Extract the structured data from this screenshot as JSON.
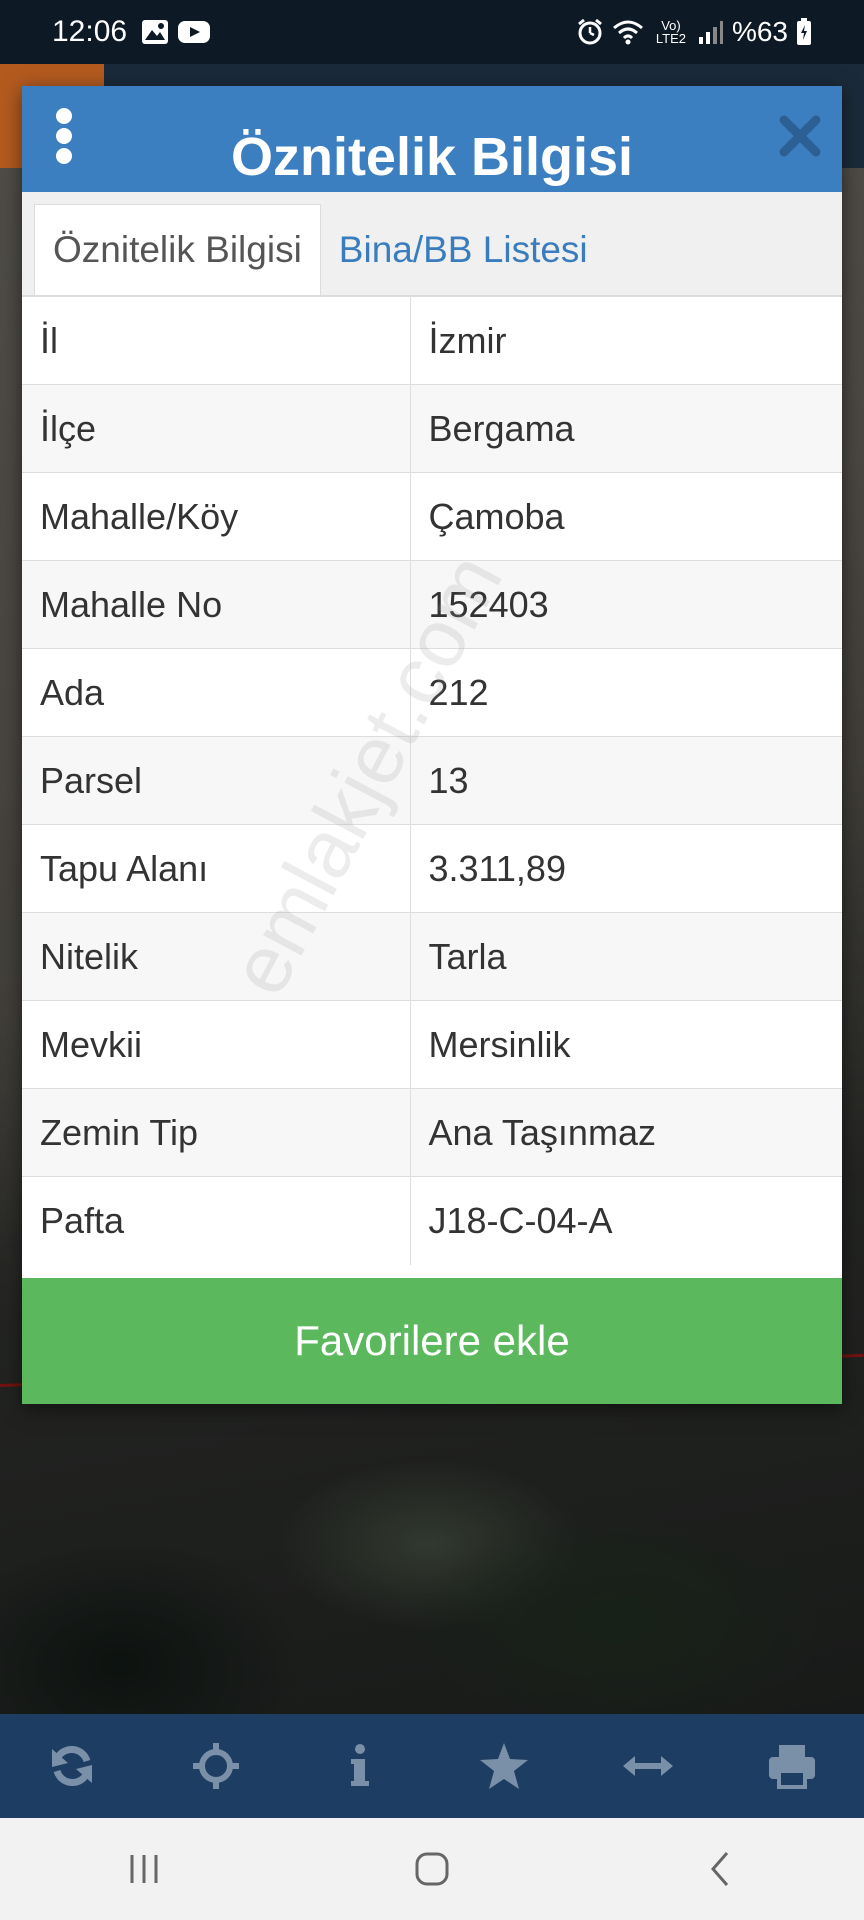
{
  "status_bar": {
    "time": "12:06",
    "battery_text": "%63",
    "network_label": "Vo) LTE2",
    "left_icons": [
      "gallery-icon",
      "youtube-icon"
    ],
    "right_icons": [
      "alarm-icon",
      "wifi-icon",
      "signal-icon",
      "battery-icon"
    ]
  },
  "dialog": {
    "title": "Öznitelik Bilgisi",
    "tabs": [
      {
        "label": "Öznitelik Bilgisi",
        "active": true
      },
      {
        "label": "Bina/BB Listesi",
        "active": false
      }
    ],
    "rows": [
      {
        "key": "İl",
        "value": "İzmir"
      },
      {
        "key": "İlçe",
        "value": "Bergama"
      },
      {
        "key": "Mahalle/Köy",
        "value": "Çamoba"
      },
      {
        "key": "Mahalle No",
        "value": "152403"
      },
      {
        "key": "Ada",
        "value": "212"
      },
      {
        "key": "Parsel",
        "value": "13"
      },
      {
        "key": "Tapu Alanı",
        "value": "3.311,89"
      },
      {
        "key": "Nitelik",
        "value": "Tarla"
      },
      {
        "key": "Mevkii",
        "value": "Mersinlik"
      },
      {
        "key": "Zemin Tip",
        "value": "Ana Taşınmaz"
      },
      {
        "key": "Pafta",
        "value": "J18-C-04-A"
      }
    ],
    "favorite_button": "Favorilere ekle",
    "watermark": "emlakjet.com"
  },
  "toolbar": {
    "icons": [
      "refresh-icon",
      "locate-icon",
      "info-icon",
      "star-icon",
      "measure-icon",
      "print-icon"
    ]
  },
  "colors": {
    "header_blue": "#3c7fc1",
    "tab_link_blue": "#3a7dbf",
    "favorite_green": "#5cb85c",
    "toolbar_navy": "#1d3d63"
  }
}
